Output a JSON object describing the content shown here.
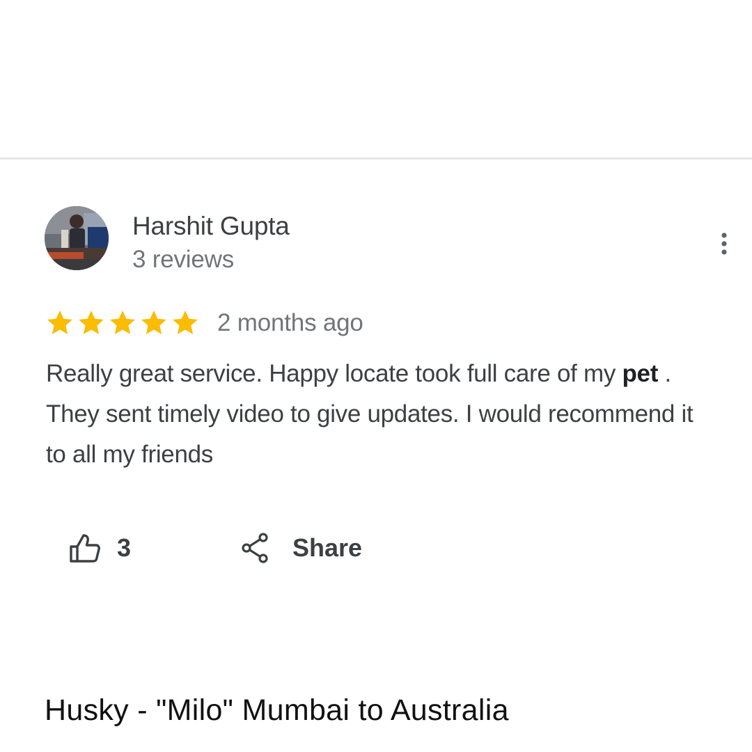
{
  "review": {
    "reviewer_name": "Harshit Gupta",
    "reviewer_meta": "3 reviews",
    "rating": 5,
    "rating_max": 5,
    "star_color": "#fbbc04",
    "date": "2 months ago",
    "text_part1": "Really great service. Happy locate took full care of my ",
    "text_bold": "pet",
    "text_part2": " . They sent timely video to give updates. I would recommend it to all my friends"
  },
  "actions": {
    "like_icon": "thumbs-up-icon",
    "like_count": "3",
    "share_icon": "share-icon",
    "share_label": "Share",
    "more_icon": "more-vertical-icon"
  },
  "caption": "Husky - \"Milo\" Mumbai to Australia"
}
